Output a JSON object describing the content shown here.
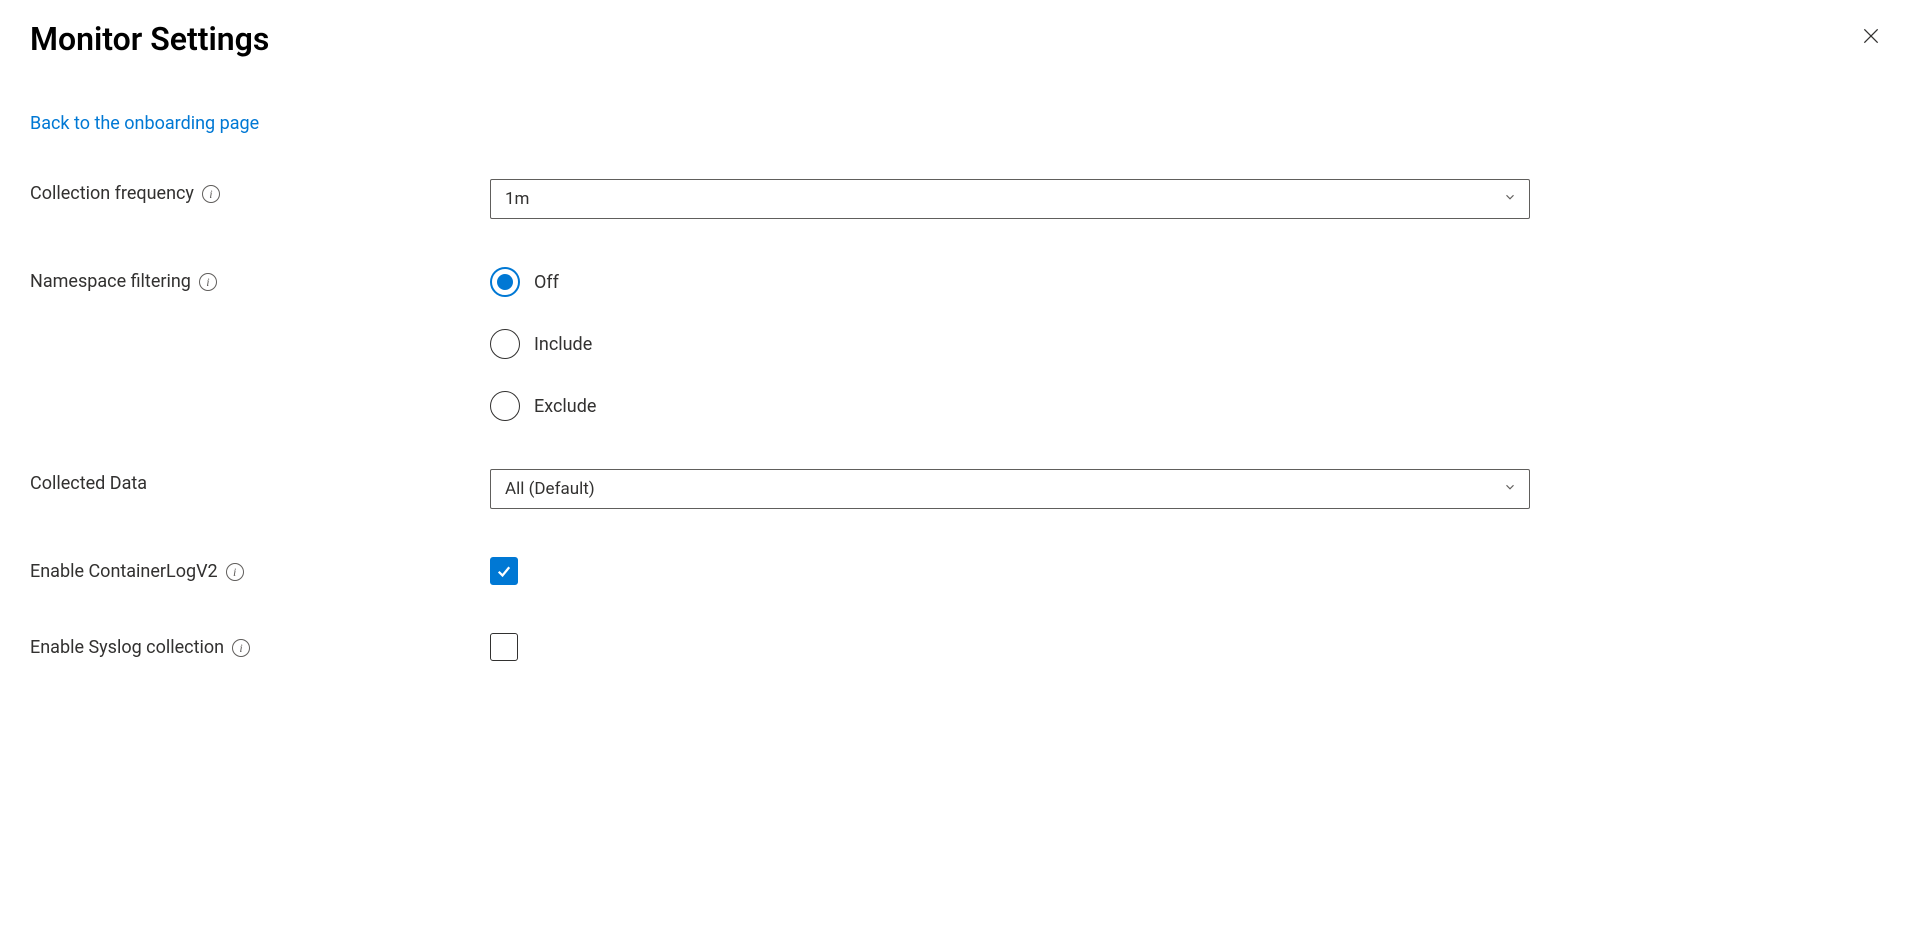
{
  "title": "Monitor Settings",
  "backLink": "Back to the onboarding page",
  "fields": {
    "collectionFrequency": {
      "label": "Collection frequency",
      "value": "1m"
    },
    "namespaceFiltering": {
      "label": "Namespace filtering",
      "options": [
        "Off",
        "Include",
        "Exclude"
      ],
      "selected": "Off"
    },
    "collectedData": {
      "label": "Collected Data",
      "value": "All (Default)"
    },
    "enableContainerLogV2": {
      "label": "Enable ContainerLogV2",
      "checked": true
    },
    "enableSyslogCollection": {
      "label": "Enable Syslog collection",
      "checked": false
    }
  }
}
